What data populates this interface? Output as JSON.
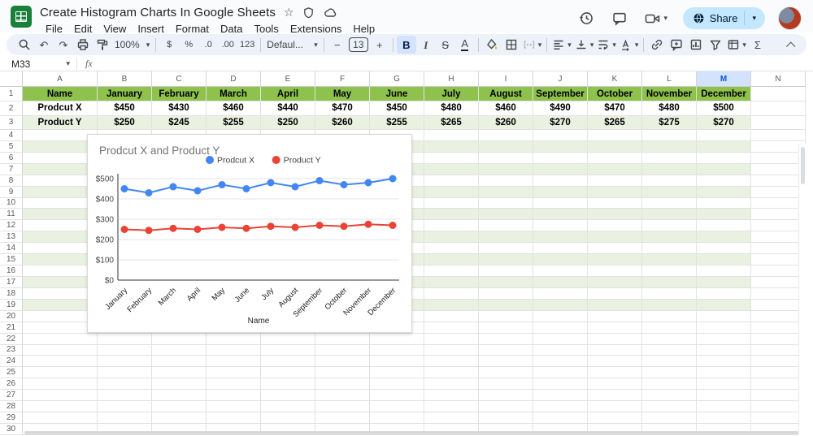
{
  "titlebar": {
    "doc_title": "Create Histogram Charts In Google Sheets",
    "menus": [
      "File",
      "Edit",
      "View",
      "Insert",
      "Format",
      "Data",
      "Tools",
      "Extensions",
      "Help"
    ],
    "share_label": "Share"
  },
  "toolbar": {
    "zoom_value": "100%",
    "font_value": "Defaul...",
    "font_size_value": "13",
    "items": [
      {
        "name": "search",
        "type": "icon",
        "icon": "search-icon"
      },
      {
        "name": "undo",
        "type": "glyph",
        "glyph": "↶"
      },
      {
        "name": "redo",
        "type": "glyph",
        "glyph": "↷"
      },
      {
        "name": "print",
        "type": "icon",
        "icon": "print-icon"
      },
      {
        "name": "paint-format",
        "type": "icon",
        "icon": "paint-roller-icon"
      },
      {
        "name": "zoom",
        "type": "text",
        "label": "100%",
        "caret": true
      },
      {
        "type": "divider"
      },
      {
        "name": "format-currency",
        "type": "glyph",
        "glyph": "$",
        "small": true
      },
      {
        "name": "format-percent",
        "type": "glyph",
        "glyph": "%",
        "small": true
      },
      {
        "name": "decrease-decimal",
        "type": "glyph",
        "glyph": ".0",
        "small": true
      },
      {
        "name": "increase-decimal",
        "type": "glyph",
        "glyph": ".00",
        "small": true
      },
      {
        "name": "more-formats",
        "type": "glyph",
        "glyph": "123",
        "small": true
      },
      {
        "type": "divider"
      },
      {
        "name": "font-family",
        "type": "text",
        "label": "Defaul...",
        "caret": true,
        "wide": true
      },
      {
        "type": "divider"
      },
      {
        "name": "decrease-font-size",
        "type": "glyph",
        "glyph": "−"
      },
      {
        "name": "font-size",
        "type": "box",
        "label": "13"
      },
      {
        "name": "increase-font-size",
        "type": "glyph",
        "glyph": "+"
      },
      {
        "type": "divider"
      },
      {
        "name": "bold",
        "type": "glyph",
        "glyph": "B",
        "active": true,
        "style": "bold"
      },
      {
        "name": "italic",
        "type": "glyph",
        "glyph": "I",
        "style": "ital"
      },
      {
        "name": "strikethrough",
        "type": "glyph",
        "glyph": "S",
        "style": "strike"
      },
      {
        "name": "text-color",
        "type": "glyph",
        "glyph": "A",
        "style": "und"
      },
      {
        "type": "divider"
      },
      {
        "name": "fill-color",
        "type": "icon",
        "icon": "fill-icon"
      },
      {
        "name": "borders",
        "type": "icon",
        "icon": "borders-icon"
      },
      {
        "name": "merge-cells",
        "type": "icon",
        "icon": "merge-icon",
        "disabled": true,
        "caret": true
      },
      {
        "type": "divider"
      },
      {
        "name": "horizontal-align",
        "type": "icon",
        "icon": "halign-icon",
        "caret": true
      },
      {
        "name": "vertical-align",
        "type": "icon",
        "icon": "valign-icon",
        "caret": true
      },
      {
        "name": "text-wrap",
        "type": "icon",
        "icon": "wrap-icon",
        "caret": true
      },
      {
        "name": "text-rotation",
        "type": "icon",
        "icon": "rotate-icon",
        "caret": true
      },
      {
        "type": "divider"
      },
      {
        "name": "insert-link",
        "type": "icon",
        "icon": "link-icon"
      },
      {
        "name": "insert-comment",
        "type": "icon",
        "icon": "comment-plus-icon"
      },
      {
        "name": "insert-chart",
        "type": "icon",
        "icon": "chart-icon"
      },
      {
        "name": "create-filter",
        "type": "icon",
        "icon": "filter-icon"
      },
      {
        "name": "table-views",
        "type": "icon",
        "icon": "views-icon",
        "caret": true
      },
      {
        "name": "functions",
        "type": "glyph",
        "glyph": "Σ"
      }
    ]
  },
  "formula_bar": {
    "cell_ref": "M33",
    "fx_label": "fx"
  },
  "grid": {
    "columns": [
      "A",
      "B",
      "C",
      "D",
      "E",
      "F",
      "G",
      "H",
      "I",
      "J",
      "K",
      "L",
      "M",
      "N"
    ],
    "selected_column": "M",
    "visible_rows": 30,
    "banded_odd_rows_through": 19,
    "table": {
      "headers": [
        "Name",
        "January",
        "February",
        "March",
        "April",
        "May",
        "June",
        "July",
        "August",
        "September",
        "October",
        "November",
        "December"
      ],
      "rows": [
        {
          "name": "Prodcut X",
          "values": [
            "$450",
            "$430",
            "$460",
            "$440",
            "$470",
            "$450",
            "$480",
            "$460",
            "$490",
            "$470",
            "$480",
            "$500"
          ]
        },
        {
          "name": "Product Y",
          "values": [
            "$250",
            "$245",
            "$255",
            "$250",
            "$260",
            "$255",
            "$265",
            "$260",
            "$270",
            "$265",
            "$275",
            "$270"
          ]
        }
      ]
    }
  },
  "chart_data": {
    "type": "line",
    "title": "Prodcut X and Product Y",
    "categories": [
      "January",
      "February",
      "March",
      "April",
      "May",
      "June",
      "July",
      "August",
      "September",
      "October",
      "November",
      "December"
    ],
    "series": [
      {
        "name": "Prodcut X",
        "color": "#4285F4",
        "values": [
          450,
          430,
          460,
          440,
          470,
          450,
          480,
          460,
          490,
          470,
          480,
          500
        ]
      },
      {
        "name": "Product Y",
        "color": "#EA4335",
        "values": [
          250,
          245,
          255,
          250,
          260,
          255,
          265,
          260,
          270,
          265,
          275,
          270
        ]
      }
    ],
    "xlabel": "Name",
    "ylabel": "",
    "ylim": [
      0,
      500
    ],
    "ytick_labels": [
      "$0",
      "$100",
      "$200",
      "$300",
      "$400",
      "$500"
    ],
    "grid": true,
    "legend_position": "top",
    "point_radius": 4.5
  },
  "colors": {
    "header_green": "#8ec24d",
    "band_green": "#e9f1e0",
    "selected_col": "#d3e3fd",
    "share_pill": "#c2e7ff",
    "toolbar_bg": "#edf2fa",
    "series_blue": "#4285F4",
    "series_red": "#EA4335"
  }
}
